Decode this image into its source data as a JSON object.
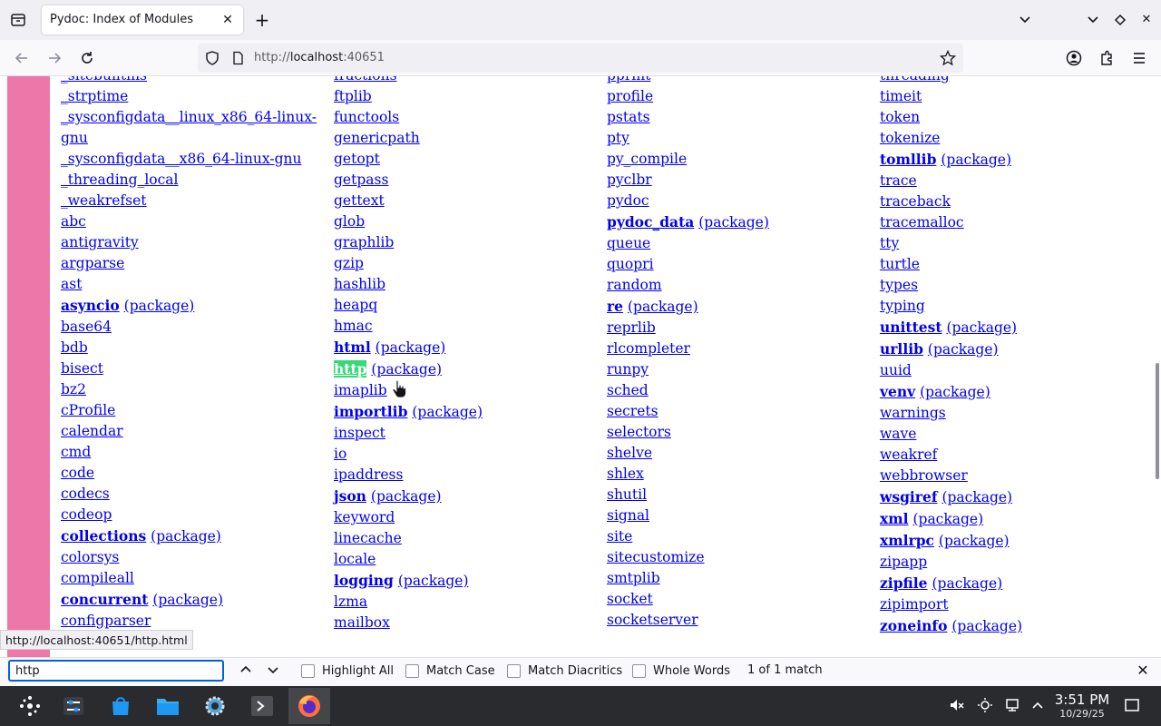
{
  "browser": {
    "tab_title": "Pydoc: Index of Modules",
    "url_prefix": "http://",
    "url_host": "localhost",
    "url_port": ":40651",
    "status_url": "http://localhost:40651/http.html"
  },
  "modules": {
    "package_suffix": "(package)",
    "highlighted_text": "http",
    "col1": [
      {
        "name": "_sitebuiltins"
      },
      {
        "name": "_strptime"
      },
      {
        "name": "_sysconfigdata__linux_x86_64-linux-"
      },
      {
        "name": "gnu"
      },
      {
        "name": "_sysconfigdata__x86_64-linux-gnu"
      },
      {
        "name": "_threading_local"
      },
      {
        "name": "_weakrefset"
      },
      {
        "name": "abc"
      },
      {
        "name": "antigravity"
      },
      {
        "name": "argparse"
      },
      {
        "name": "ast"
      },
      {
        "name": "asyncio",
        "pkg": true
      },
      {
        "name": "base64"
      },
      {
        "name": "bdb"
      },
      {
        "name": "bisect"
      },
      {
        "name": "bz2"
      },
      {
        "name": "cProfile"
      },
      {
        "name": "calendar"
      },
      {
        "name": "cmd"
      },
      {
        "name": "code"
      },
      {
        "name": "codecs"
      },
      {
        "name": "codeop"
      },
      {
        "name": "collections",
        "pkg": true
      },
      {
        "name": "colorsys"
      },
      {
        "name": "compileall"
      },
      {
        "name": "concurrent",
        "pkg": true
      },
      {
        "name": "configparser"
      }
    ],
    "col2": [
      {
        "name": "fractions"
      },
      {
        "name": "ftplib"
      },
      {
        "name": "functools"
      },
      {
        "name": "genericpath"
      },
      {
        "name": "getopt"
      },
      {
        "name": "getpass"
      },
      {
        "name": "gettext"
      },
      {
        "name": "glob"
      },
      {
        "name": "graphlib"
      },
      {
        "name": "gzip"
      },
      {
        "name": "hashlib"
      },
      {
        "name": "heapq"
      },
      {
        "name": "hmac"
      },
      {
        "name": "html",
        "pkg": true
      },
      {
        "name": "http",
        "pkg": true,
        "highlight": true
      },
      {
        "name": "imaplib"
      },
      {
        "name": "importlib",
        "pkg": true
      },
      {
        "name": "inspect"
      },
      {
        "name": "io"
      },
      {
        "name": "ipaddress"
      },
      {
        "name": "json",
        "pkg": true
      },
      {
        "name": "keyword"
      },
      {
        "name": "linecache"
      },
      {
        "name": "locale"
      },
      {
        "name": "logging",
        "pkg": true
      },
      {
        "name": "lzma"
      },
      {
        "name": "mailbox"
      }
    ],
    "col3": [
      {
        "name": "pprint"
      },
      {
        "name": "profile"
      },
      {
        "name": "pstats"
      },
      {
        "name": "pty"
      },
      {
        "name": "py_compile"
      },
      {
        "name": "pyclbr"
      },
      {
        "name": "pydoc"
      },
      {
        "name": "pydoc_data",
        "pkg": true
      },
      {
        "name": "queue"
      },
      {
        "name": "quopri"
      },
      {
        "name": "random"
      },
      {
        "name": "re",
        "pkg": true
      },
      {
        "name": "reprlib"
      },
      {
        "name": "rlcompleter"
      },
      {
        "name": "runpy"
      },
      {
        "name": "sched"
      },
      {
        "name": "secrets"
      },
      {
        "name": "selectors"
      },
      {
        "name": "shelve"
      },
      {
        "name": "shlex"
      },
      {
        "name": "shutil"
      },
      {
        "name": "signal"
      },
      {
        "name": "site"
      },
      {
        "name": "sitecustomize"
      },
      {
        "name": "smtplib"
      },
      {
        "name": "socket"
      },
      {
        "name": "socketserver"
      }
    ],
    "col4": [
      {
        "name": "threading"
      },
      {
        "name": "timeit"
      },
      {
        "name": "token"
      },
      {
        "name": "tokenize"
      },
      {
        "name": "tomllib",
        "pkg": true
      },
      {
        "name": "trace"
      },
      {
        "name": "traceback"
      },
      {
        "name": "tracemalloc"
      },
      {
        "name": "tty"
      },
      {
        "name": "turtle"
      },
      {
        "name": "types"
      },
      {
        "name": "typing"
      },
      {
        "name": "unittest",
        "pkg": true
      },
      {
        "name": "urllib",
        "pkg": true
      },
      {
        "name": "uuid"
      },
      {
        "name": "venv",
        "pkg": true
      },
      {
        "name": "warnings"
      },
      {
        "name": "wave"
      },
      {
        "name": "weakref"
      },
      {
        "name": "webbrowser"
      },
      {
        "name": "wsgiref",
        "pkg": true
      },
      {
        "name": "xml",
        "pkg": true
      },
      {
        "name": "xmlrpc",
        "pkg": true
      },
      {
        "name": "zipapp"
      },
      {
        "name": "zipfile",
        "pkg": true
      },
      {
        "name": "zipimport"
      },
      {
        "name": "zoneinfo",
        "pkg": true
      }
    ]
  },
  "findbar": {
    "query": "http",
    "highlight_all": "Highlight All",
    "match_case": "Match Case",
    "match_diacritics": "Match Diacritics",
    "whole_words": "Whole Words",
    "result": "1 of 1 match"
  },
  "taskbar": {
    "time": "3:51 PM",
    "date": "10/29/25"
  },
  "icons": {
    "tab_list": "tab-list-icon",
    "back": "back-arrow-icon",
    "forward": "forward-arrow-icon",
    "reload": "reload-icon",
    "shield": "tracking-protection-shield-icon",
    "page": "page-info-icon",
    "bookmark": "star-icon",
    "account": "account-icon",
    "extensions": "extensions-icon",
    "menu": "hamburger-menu-icon"
  },
  "colors": {
    "sidebar_pink": "#ee77aa",
    "link": "#0000ee",
    "find_highlight": "#38d878",
    "taskbar": "#2a2b2f"
  }
}
